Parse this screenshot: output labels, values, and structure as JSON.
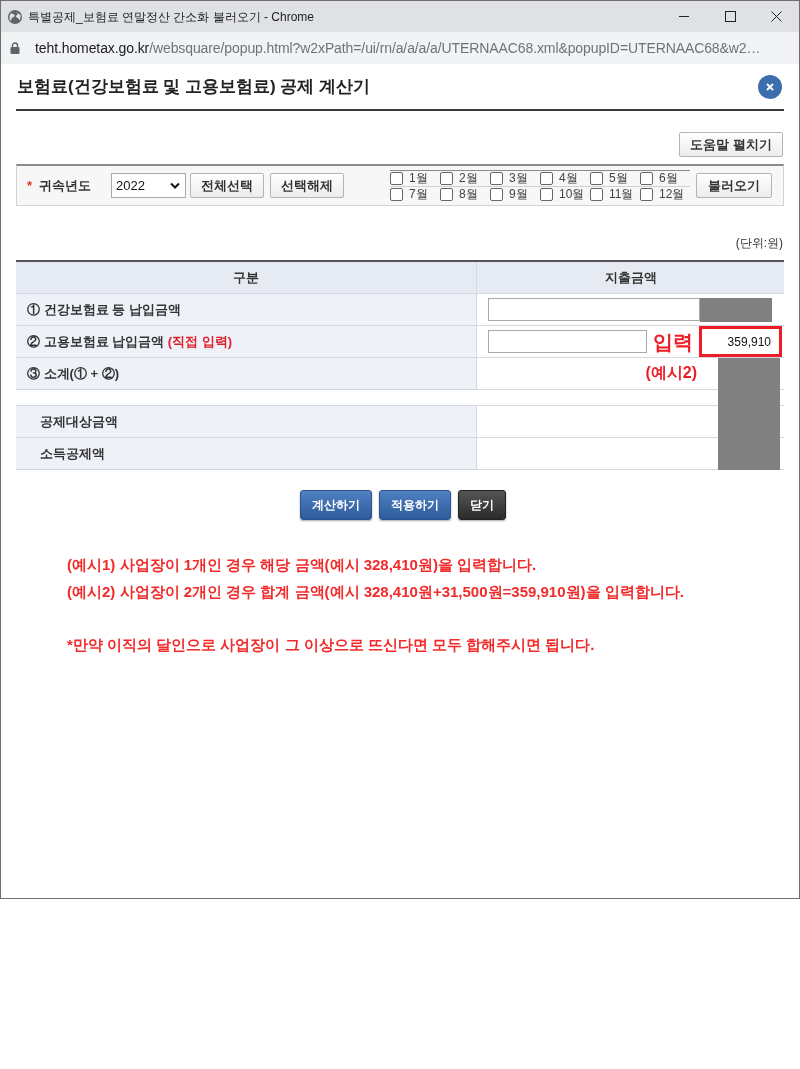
{
  "window": {
    "title": "특별공제_보험료 연말정산 간소화 불러오기 - Chrome",
    "url_host": "teht.hometax.go.kr",
    "url_path": "/websquare/popup.html?w2xPath=/ui/rn/a/a/a/a/UTERNAAC68.xml&popupID=UTERNAAC68&w2…"
  },
  "dialog": {
    "title": "보험료(건강보험료 및 고용보험료) 공제 계산기",
    "help_button": "도움말 펼치기"
  },
  "filter": {
    "required_mark": "*",
    "label": "귀속년도",
    "year": "2022",
    "buttons": [
      "전체선택",
      "선택해제"
    ],
    "months": [
      {
        "label": "1월",
        "checked": false
      },
      {
        "label": "2월",
        "checked": false
      },
      {
        "label": "3월",
        "checked": false
      },
      {
        "label": "4월",
        "checked": false
      },
      {
        "label": "5월",
        "checked": false
      },
      {
        "label": "6월",
        "checked": false
      },
      {
        "label": "7월",
        "checked": false
      },
      {
        "label": "8월",
        "checked": false
      },
      {
        "label": "9월",
        "checked": false
      },
      {
        "label": "10월",
        "checked": false
      },
      {
        "label": "11월",
        "checked": false
      },
      {
        "label": "12월",
        "checked": false
      }
    ],
    "load_button": "불러오기"
  },
  "unit_note": "(단위:원)",
  "table": {
    "columns": [
      "구분",
      "지출금액"
    ],
    "rows": [
      {
        "kind": "input",
        "label": "① 건강보험료 등 납입금액",
        "masked": true
      },
      {
        "kind": "input",
        "label": "② 고용보험료 납입금액",
        "note": "(직접 입력)",
        "callout": "입력",
        "value": "359,910",
        "highlighted": true,
        "masked": false
      },
      {
        "kind": "total",
        "label": "③ 소계(① + ②)",
        "callout": "(예시2)",
        "masked": true
      },
      {
        "kind": "spacer",
        "masked": true
      },
      {
        "kind": "result",
        "label": "공제대상금액",
        "masked": true
      },
      {
        "kind": "result",
        "label": "소득공제액",
        "masked": true
      }
    ]
  },
  "actions": [
    {
      "label": "계산하기",
      "kind": "primary"
    },
    {
      "label": "적용하기",
      "kind": "primary"
    },
    {
      "label": "닫기",
      "kind": "dark"
    }
  ],
  "examples": [
    "(예시1) 사업장이 1개인 경우 해당 금액(예시 328,410원)을 입력합니다.",
    "(예시2) 사업장이 2개인 경우 합계 금액(예시 328,410원+31,500원=359,910원)을 입력합니다."
  ],
  "footnote": "*만약 이직의 달인으로 사업장이 그 이상으로 뜨신다면 모두 합해주시면 됩니다."
}
